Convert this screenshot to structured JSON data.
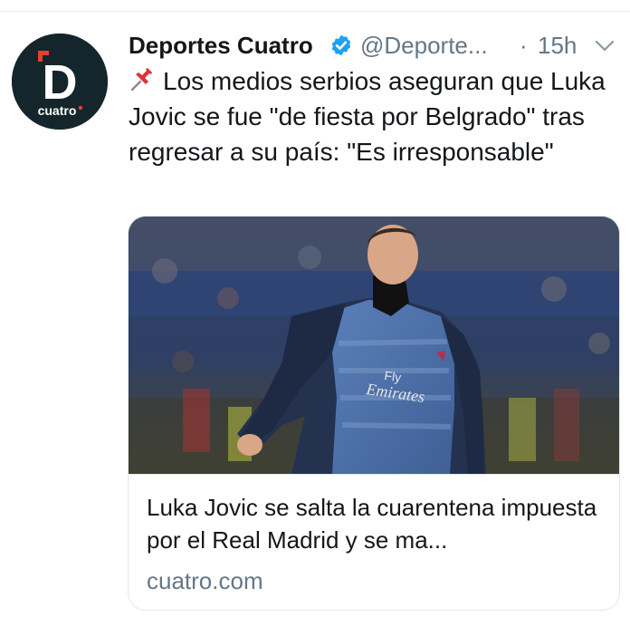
{
  "tweet": {
    "author_name": "Deportes Cuatro",
    "handle": "@Deporte...",
    "separator": "·",
    "time": "15h",
    "text": "Los medios serbios aseguran que Luka Jovic se fue \"de fiesta por Belgrado\" tras regresar a su país: \"Es irresponsable\"",
    "avatar": {
      "letter": "D",
      "wordmark": "cuatro"
    }
  },
  "card": {
    "title": "Luka Jovic se salta la cuarentena impuesta por el Real Madrid y se ma...",
    "domain": "cuatro.com",
    "image": {
      "shirt_text_1": "Fly",
      "shirt_text_2": "Emirates"
    }
  },
  "icons": {
    "verified": "verified-badge-icon",
    "pin": "pushpin-icon",
    "caret": "chevron-down-icon"
  },
  "colors": {
    "verified": "#1da1f2",
    "secondary_text": "#657786",
    "avatar_bg": "#14262b",
    "brand_red": "#e4402f"
  }
}
